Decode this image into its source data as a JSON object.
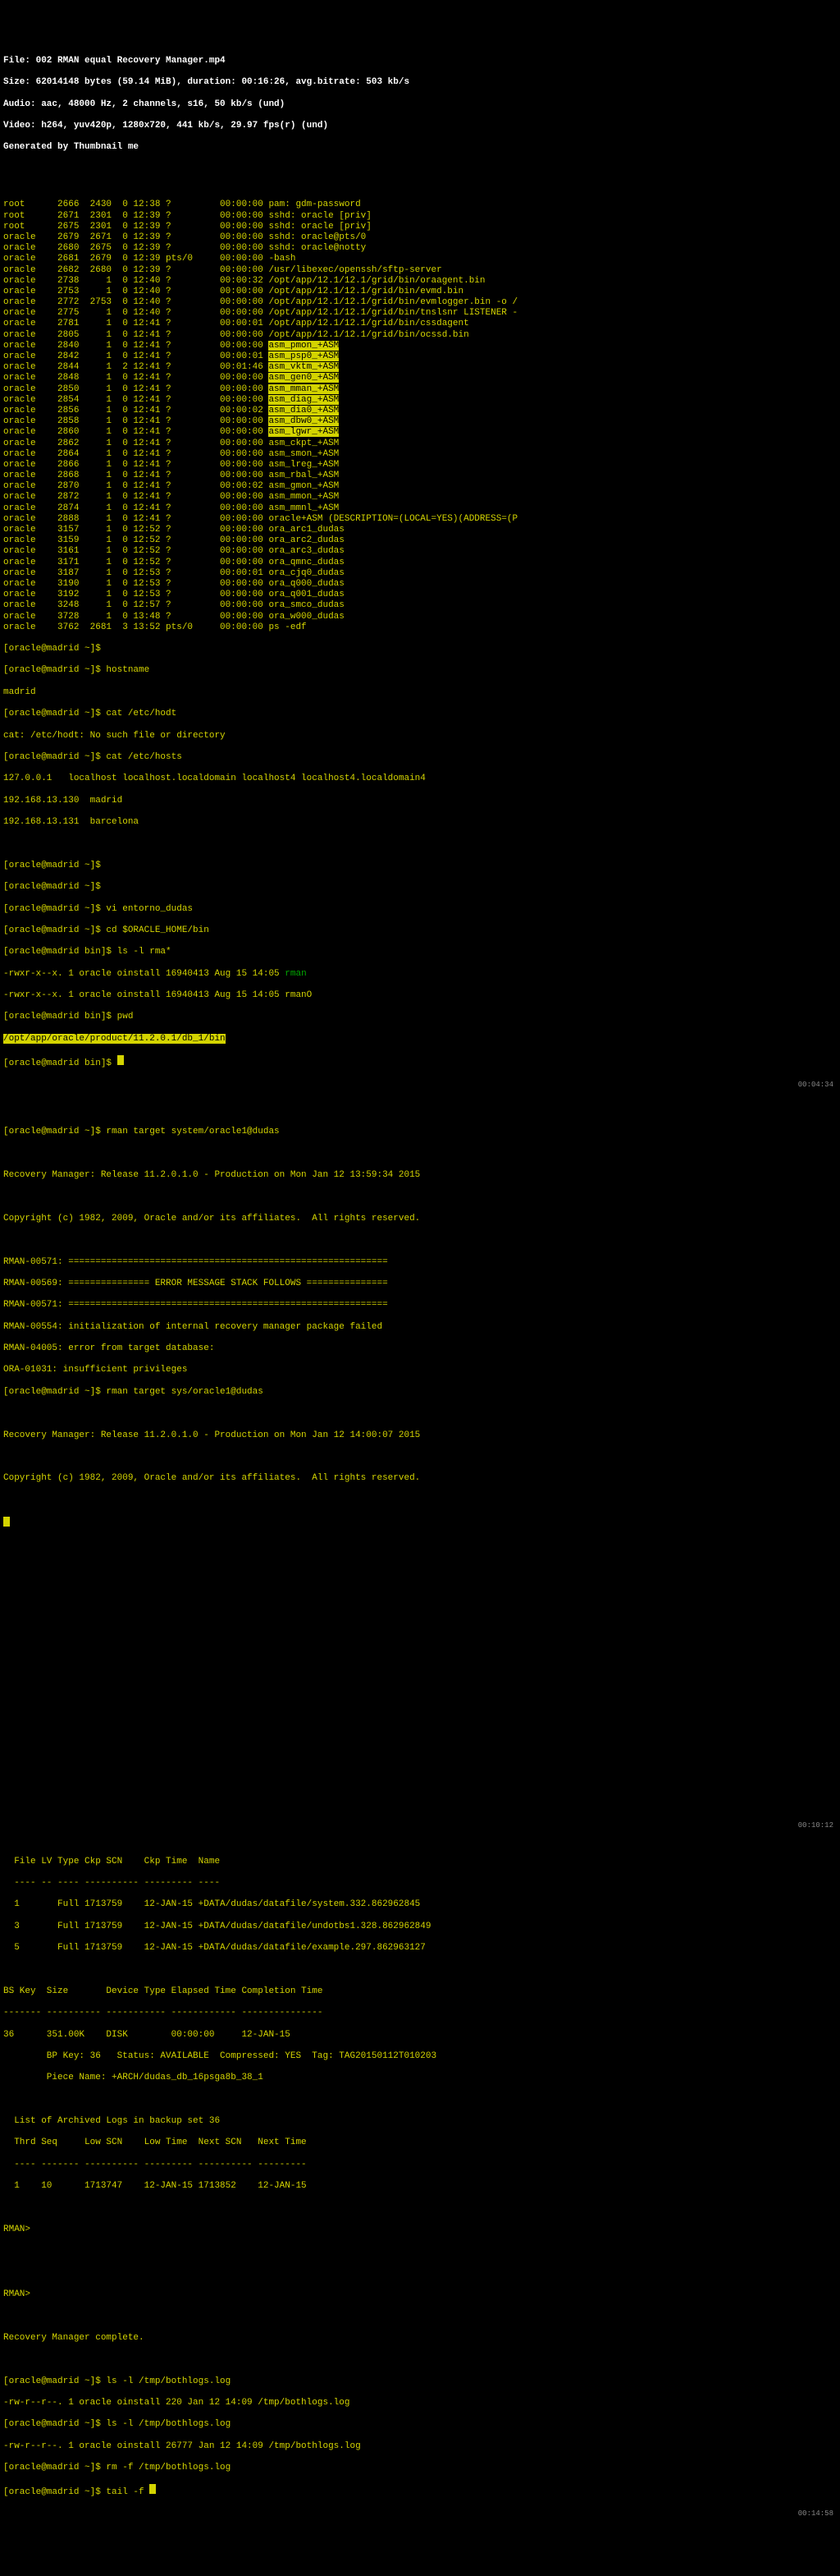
{
  "header": {
    "file": "File: 002 RMAN equal Recovery Manager.mp4",
    "size": "Size: 62014148 bytes (59.14 MiB), duration: 00:16:26, avg.bitrate: 503 kb/s",
    "audio": "Audio: aac, 48000 Hz, 2 channels, s16, 50 kb/s (und)",
    "video": "Video: h264, yuv420p, 1280x720, 441 kb/s, 29.97 fps(r) (und)",
    "generated": "Generated by Thumbnail me"
  },
  "ps_rows": [
    {
      "user": "root",
      "pid": "2666",
      "ppid": "2430",
      "c": "0",
      "time": "12:38",
      "tty": "?",
      "elapsed": "00:00:00",
      "cmd": "pam: gdm-password"
    },
    {
      "user": "root",
      "pid": "2671",
      "ppid": "2301",
      "c": "0",
      "time": "12:39",
      "tty": "?",
      "elapsed": "00:00:00",
      "cmd": "sshd: oracle [priv]"
    },
    {
      "user": "root",
      "pid": "2675",
      "ppid": "2301",
      "c": "0",
      "time": "12:39",
      "tty": "?",
      "elapsed": "00:00:00",
      "cmd": "sshd: oracle [priv]"
    },
    {
      "user": "oracle",
      "pid": "2679",
      "ppid": "2671",
      "c": "0",
      "time": "12:39",
      "tty": "?",
      "elapsed": "00:00:00",
      "cmd": "sshd: oracle@pts/0"
    },
    {
      "user": "oracle",
      "pid": "2680",
      "ppid": "2675",
      "c": "0",
      "time": "12:39",
      "tty": "?",
      "elapsed": "00:00:00",
      "cmd": "sshd: oracle@notty"
    },
    {
      "user": "oracle",
      "pid": "2681",
      "ppid": "2679",
      "c": "0",
      "time": "12:39",
      "tty": "pts/0",
      "elapsed": "00:00:00",
      "cmd": "-bash"
    },
    {
      "user": "oracle",
      "pid": "2682",
      "ppid": "2680",
      "c": "0",
      "time": "12:39",
      "tty": "?",
      "elapsed": "00:00:00",
      "cmd": "/usr/libexec/openssh/sftp-server"
    },
    {
      "user": "oracle",
      "pid": "2738",
      "ppid": "1",
      "c": "0",
      "time": "12:40",
      "tty": "?",
      "elapsed": "00:00:32",
      "cmd": "/opt/app/12.1/12.1/grid/bin/oraagent.bin"
    },
    {
      "user": "oracle",
      "pid": "2753",
      "ppid": "1",
      "c": "0",
      "time": "12:40",
      "tty": "?",
      "elapsed": "00:00:00",
      "cmd": "/opt/app/12.1/12.1/grid/bin/evmd.bin"
    },
    {
      "user": "oracle",
      "pid": "2772",
      "ppid": "2753",
      "c": "0",
      "time": "12:40",
      "tty": "?",
      "elapsed": "00:00:00",
      "cmd": "/opt/app/12.1/12.1/grid/bin/evmlogger.bin -o /"
    },
    {
      "user": "oracle",
      "pid": "2775",
      "ppid": "1",
      "c": "0",
      "time": "12:40",
      "tty": "?",
      "elapsed": "00:00:00",
      "cmd": "/opt/app/12.1/12.1/grid/bin/tnslsnr LISTENER -"
    },
    {
      "user": "oracle",
      "pid": "2781",
      "ppid": "1",
      "c": "0",
      "time": "12:41",
      "tty": "?",
      "elapsed": "00:00:01",
      "cmd": "/opt/app/12.1/12.1/grid/bin/cssdagent"
    },
    {
      "user": "oracle",
      "pid": "2805",
      "ppid": "1",
      "c": "0",
      "time": "12:41",
      "tty": "?",
      "elapsed": "00:00:00",
      "cmd": "/opt/app/12.1/12.1/grid/bin/ocssd.bin"
    }
  ],
  "asm_rows_hl": [
    {
      "user": "oracle",
      "pid": "2840",
      "ppid": "1",
      "c": "0",
      "time": "12:41",
      "tty": "?",
      "elapsed": "00:00:00",
      "cmd": "asm_pmon_+ASM"
    },
    {
      "user": "oracle",
      "pid": "2842",
      "ppid": "1",
      "c": "0",
      "time": "12:41",
      "tty": "?",
      "elapsed": "00:00:01",
      "cmd": "asm_psp0_+ASM"
    },
    {
      "user": "oracle",
      "pid": "2844",
      "ppid": "1",
      "c": "2",
      "time": "12:41",
      "tty": "?",
      "elapsed": "00:01:46",
      "cmd": "asm_vktm_+ASM"
    },
    {
      "user": "oracle",
      "pid": "2848",
      "ppid": "1",
      "c": "0",
      "time": "12:41",
      "tty": "?",
      "elapsed": "00:00:00",
      "cmd": "asm_gen0_+ASM"
    },
    {
      "user": "oracle",
      "pid": "2850",
      "ppid": "1",
      "c": "0",
      "time": "12:41",
      "tty": "?",
      "elapsed": "00:00:00",
      "cmd": "asm_mman_+ASM"
    },
    {
      "user": "oracle",
      "pid": "2854",
      "ppid": "1",
      "c": "0",
      "time": "12:41",
      "tty": "?",
      "elapsed": "00:00:00",
      "cmd": "asm_diag_+ASM"
    },
    {
      "user": "oracle",
      "pid": "2856",
      "ppid": "1",
      "c": "0",
      "time": "12:41",
      "tty": "?",
      "elapsed": "00:00:02",
      "cmd": "asm_dia0_+ASM"
    },
    {
      "user": "oracle",
      "pid": "2858",
      "ppid": "1",
      "c": "0",
      "time": "12:41",
      "tty": "?",
      "elapsed": "00:00:00",
      "cmd": "asm_dbw0_+ASM"
    },
    {
      "user": "oracle",
      "pid": "2860",
      "ppid": "1",
      "c": "0",
      "time": "12:41",
      "tty": "?",
      "elapsed": "00:00:00",
      "cmd": "asm_lgwr_+ASM"
    }
  ],
  "asm_rows_plain": [
    {
      "user": "oracle",
      "pid": "2862",
      "ppid": "1",
      "c": "0",
      "time": "12:41",
      "tty": "?",
      "elapsed": "00:00:00",
      "cmd": "asm_ckpt_+ASM"
    },
    {
      "user": "oracle",
      "pid": "2864",
      "ppid": "1",
      "c": "0",
      "time": "12:41",
      "tty": "?",
      "elapsed": "00:00:00",
      "cmd": "asm_smon_+ASM"
    },
    {
      "user": "oracle",
      "pid": "2866",
      "ppid": "1",
      "c": "0",
      "time": "12:41",
      "tty": "?",
      "elapsed": "00:00:00",
      "cmd": "asm_lreg_+ASM"
    },
    {
      "user": "oracle",
      "pid": "2868",
      "ppid": "1",
      "c": "0",
      "time": "12:41",
      "tty": "?",
      "elapsed": "00:00:00",
      "cmd": "asm_rbal_+ASM"
    },
    {
      "user": "oracle",
      "pid": "2870",
      "ppid": "1",
      "c": "0",
      "time": "12:41",
      "tty": "?",
      "elapsed": "00:00:02",
      "cmd": "asm_gmon_+ASM"
    },
    {
      "user": "oracle",
      "pid": "2872",
      "ppid": "1",
      "c": "0",
      "time": "12:41",
      "tty": "?",
      "elapsed": "00:00:00",
      "cmd": "asm_mmon_+ASM"
    },
    {
      "user": "oracle",
      "pid": "2874",
      "ppid": "1",
      "c": "0",
      "time": "12:41",
      "tty": "?",
      "elapsed": "00:00:00",
      "cmd": "asm_mmnl_+ASM"
    },
    {
      "user": "oracle",
      "pid": "2888",
      "ppid": "1",
      "c": "0",
      "time": "12:41",
      "tty": "?",
      "elapsed": "00:00:00",
      "cmd": "oracle+ASM (DESCRIPTION=(LOCAL=YES)(ADDRESS=(P"
    },
    {
      "user": "oracle",
      "pid": "3157",
      "ppid": "1",
      "c": "0",
      "time": "12:52",
      "tty": "?",
      "elapsed": "00:00:00",
      "cmd": "ora_arc1_dudas"
    },
    {
      "user": "oracle",
      "pid": "3159",
      "ppid": "1",
      "c": "0",
      "time": "12:52",
      "tty": "?",
      "elapsed": "00:00:00",
      "cmd": "ora_arc2_dudas"
    },
    {
      "user": "oracle",
      "pid": "3161",
      "ppid": "1",
      "c": "0",
      "time": "12:52",
      "tty": "?",
      "elapsed": "00:00:00",
      "cmd": "ora_arc3_dudas"
    },
    {
      "user": "oracle",
      "pid": "3171",
      "ppid": "1",
      "c": "0",
      "time": "12:52",
      "tty": "?",
      "elapsed": "00:00:00",
      "cmd": "ora_qmnc_dudas"
    },
    {
      "user": "oracle",
      "pid": "3187",
      "ppid": "1",
      "c": "0",
      "time": "12:53",
      "tty": "?",
      "elapsed": "00:00:01",
      "cmd": "ora_cjq0_dudas"
    },
    {
      "user": "oracle",
      "pid": "3190",
      "ppid": "1",
      "c": "0",
      "time": "12:53",
      "tty": "?",
      "elapsed": "00:00:00",
      "cmd": "ora_q000_dudas"
    },
    {
      "user": "oracle",
      "pid": "3192",
      "ppid": "1",
      "c": "0",
      "time": "12:53",
      "tty": "?",
      "elapsed": "00:00:00",
      "cmd": "ora_q001_dudas"
    },
    {
      "user": "oracle",
      "pid": "3248",
      "ppid": "1",
      "c": "0",
      "time": "12:57",
      "tty": "?",
      "elapsed": "00:00:00",
      "cmd": "ora_smco_dudas"
    },
    {
      "user": "oracle",
      "pid": "3728",
      "ppid": "1",
      "c": "0",
      "time": "13:48",
      "tty": "?",
      "elapsed": "00:00:00",
      "cmd": "ora_w000_dudas"
    },
    {
      "user": "oracle",
      "pid": "3762",
      "ppid": "2681",
      "c": "3",
      "time": "13:52",
      "tty": "pts/0",
      "elapsed": "00:00:00",
      "cmd": "ps -edf"
    }
  ],
  "shell1": {
    "p1": "[oracle@madrid ~]$",
    "p2": "[oracle@madrid ~]$ hostname",
    "out_host": "madrid",
    "p3": "[oracle@madrid ~]$ cat /etc/hodt",
    "err_cat": "cat: /etc/hodt: No such file or directory",
    "p4": "[oracle@madrid ~]$ cat /etc/hosts",
    "hosts1": "127.0.0.1   localhost localhost.localdomain localhost4 localhost4.localdomain4",
    "hosts2": "192.168.13.130  madrid",
    "hosts3": "192.168.13.131  barcelona",
    "blank": "",
    "p5": "[oracle@madrid ~]$",
    "p6": "[oracle@madrid ~]$",
    "p7": "[oracle@madrid ~]$ vi entorno_dudas",
    "p8": "[oracle@madrid ~]$ cd $ORACLE_HOME/bin",
    "p9": "[oracle@madrid bin]$ ls -l rma*",
    "ls1": "-rwxr-x--x. 1 oracle oinstall 16940413 Aug 15 14:05 ",
    "ls1b": "rman",
    "ls2": "-rwxr-x--x. 1 oracle oinstall 16940413 Aug 15 14:05 rmanO",
    "p10": "[oracle@madrid bin]$ pwd",
    "pwd": "/opt/app/oracle/product/11.2.0.1/db_1/bin",
    "p11": "[oracle@madrid bin]$ "
  },
  "ts1": "00:04:34",
  "rman1": {
    "p1": "[oracle@madrid ~]$ rman target system/oracle1@dudas",
    "rel": "Recovery Manager: Release 11.2.0.1.0 - Production on Mon Jan 12 13:59:34 2015",
    "cop": "Copyright (c) 1982, 2009, Oracle and/or its affiliates.  All rights reserved.",
    "e1": "RMAN-00571: ===========================================================",
    "e2": "RMAN-00569: =============== ERROR MESSAGE STACK FOLLOWS ===============",
    "e3": "RMAN-00571: ===========================================================",
    "e4": "RMAN-00554: initialization of internal recovery manager package failed",
    "e5": "RMAN-04005: error from target database:",
    "e6": "ORA-01031: insufficient privileges",
    "p2": "[oracle@madrid ~]$ rman target sys/oracle1@dudas",
    "rel2": "Recovery Manager: Release 11.2.0.1.0 - Production on Mon Jan 12 14:00:07 2015",
    "cop2": "Copyright (c) 1982, 2009, Oracle and/or its affiliates.  All rights reserved."
  },
  "ts2": "00:10:12",
  "backup": {
    "hdr1": "  File LV Type Ckp SCN    Ckp Time  Name",
    "sep1": "  ---- -- ---- ---------- --------- ----",
    "r1": "  1       Full 1713759    12-JAN-15 +DATA/dudas/datafile/system.332.862962845",
    "r2": "  3       Full 1713759    12-JAN-15 +DATA/dudas/datafile/undotbs1.328.862962849",
    "r3": "  5       Full 1713759    12-JAN-15 +DATA/dudas/datafile/example.297.862963127",
    "hdr2": "BS Key  Size       Device Type Elapsed Time Completion Time",
    "sep2": "------- ---------- ----------- ------------ ---------------",
    "r4": "36      351.00K    DISK        00:00:00     12-JAN-15",
    "r5": "        BP Key: 36   Status: AVAILABLE  Compressed: YES  Tag: TAG20150112T010203",
    "r6": "        Piece Name: +ARCH/dudas_db_16psga8b_38_1",
    "r7": "  List of Archived Logs in backup set 36",
    "hdr3": "  Thrd Seq     Low SCN    Low Time  Next SCN   Next Time",
    "sep3": "  ---- ------- ---------- --------- ---------- ---------",
    "r8": "  1    10      1713747    12-JAN-15 1713852    12-JAN-15",
    "rman": "RMAN>",
    "rman2": "RMAN>",
    "complete": "Recovery Manager complete.",
    "p1": "[oracle@madrid ~]$ ls -l /tmp/bothlogs.log",
    "ls1": "-rw-r--r--. 1 oracle oinstall 220 Jan 12 14:09 /tmp/bothlogs.log",
    "p2": "[oracle@madrid ~]$ ls -l /tmp/bothlogs.log",
    "ls2": "-rw-r--r--. 1 oracle oinstall 26777 Jan 12 14:09 /tmp/bothlogs.log",
    "p3": "[oracle@madrid ~]$ rm -f /tmp/bothlogs.log",
    "p4": "[oracle@madrid ~]$ tail -f "
  },
  "ts3": "00:14:58"
}
